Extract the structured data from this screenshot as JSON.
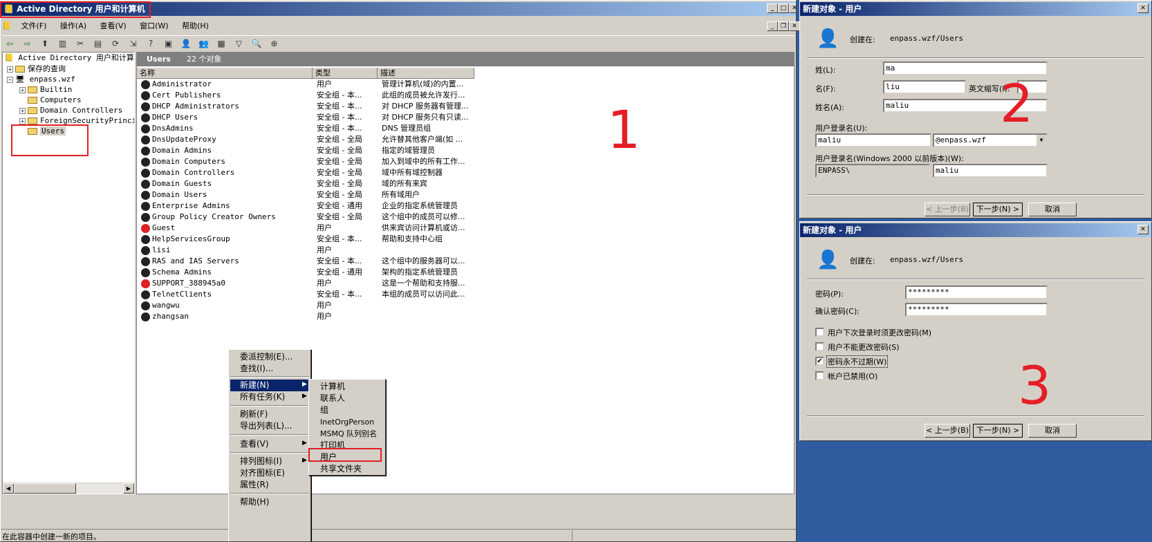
{
  "main_window": {
    "title": "Active Directory 用户和计算机",
    "menu": [
      "文件(F)",
      "操作(A)",
      "查看(V)",
      "窗口(W)",
      "帮助(H)"
    ],
    "tree_root": "Active Directory 用户和计算机",
    "tree": {
      "saved_queries": "保存的查询",
      "domain": "enpass.wzf",
      "children": [
        "Builtin",
        "Computers",
        "Domain Controllers",
        "ForeignSecurityPrincipals",
        "Users"
      ]
    },
    "panel_title": "Users",
    "object_count": "22 个对象",
    "columns": [
      "名称",
      "类型",
      "描述"
    ],
    "rows": [
      {
        "name": "Administrator",
        "type": "用户",
        "desc": "管理计算机(域)的内置...",
        "disabled": false
      },
      {
        "name": "Cert Publishers",
        "type": "安全组 - 本...",
        "desc": "此组的成员被允许发行...",
        "disabled": false
      },
      {
        "name": "DHCP Administrators",
        "type": "安全组 - 本...",
        "desc": "对 DHCP 服务器有管理...",
        "disabled": false
      },
      {
        "name": "DHCP Users",
        "type": "安全组 - 本...",
        "desc": "对 DHCP 服务只有只读...",
        "disabled": false
      },
      {
        "name": "DnsAdmins",
        "type": "安全组 - 本...",
        "desc": "DNS 管理员组",
        "disabled": false
      },
      {
        "name": "DnsUpdateProxy",
        "type": "安全组 - 全局",
        "desc": "允许替其他客户端(如 ...",
        "disabled": false
      },
      {
        "name": "Domain Admins",
        "type": "安全组 - 全局",
        "desc": "指定的域管理员",
        "disabled": false
      },
      {
        "name": "Domain Computers",
        "type": "安全组 - 全局",
        "desc": "加入到域中的所有工作...",
        "disabled": false
      },
      {
        "name": "Domain Controllers",
        "type": "安全组 - 全局",
        "desc": "域中所有域控制器",
        "disabled": false
      },
      {
        "name": "Domain Guests",
        "type": "安全组 - 全局",
        "desc": "域的所有来宾",
        "disabled": false
      },
      {
        "name": "Domain Users",
        "type": "安全组 - 全局",
        "desc": "所有域用户",
        "disabled": false
      },
      {
        "name": "Enterprise Admins",
        "type": "安全组 - 通用",
        "desc": "企业的指定系统管理员",
        "disabled": false
      },
      {
        "name": "Group Policy Creator Owners",
        "type": "安全组 - 全局",
        "desc": "这个组中的成员可以修...",
        "disabled": false
      },
      {
        "name": "Guest",
        "type": "用户",
        "desc": "供来宾访问计算机或访...",
        "disabled": true
      },
      {
        "name": "HelpServicesGroup",
        "type": "安全组 - 本...",
        "desc": "帮助和支持中心组",
        "disabled": false
      },
      {
        "name": "lisi",
        "type": "用户",
        "desc": "",
        "disabled": false
      },
      {
        "name": "RAS and IAS Servers",
        "type": "安全组 - 本...",
        "desc": "这个组中的服务器可以...",
        "disabled": false
      },
      {
        "name": "Schema Admins",
        "type": "安全组 - 通用",
        "desc": "架构的指定系统管理员",
        "disabled": false
      },
      {
        "name": "SUPPORT_388945a0",
        "type": "用户",
        "desc": "这是一个帮助和支持服...",
        "disabled": true
      },
      {
        "name": "TelnetClients",
        "type": "安全组 - 本...",
        "desc": "本组的成员可以访问此...",
        "disabled": false
      },
      {
        "name": "wangwu",
        "type": "用户",
        "desc": "",
        "disabled": false
      },
      {
        "name": "zhangsan",
        "type": "用户",
        "desc": "",
        "disabled": false
      }
    ],
    "status": "在此容器中创建一新的项目。"
  },
  "context_menu": {
    "items": [
      "委派控制(E)...",
      "查找(I)...",
      "新建(N)",
      "所有任务(K)",
      "刷新(F)",
      "导出列表(L)...",
      "查看(V)",
      "排列图标(I)",
      "对齐图标(E)",
      "属性(R)",
      "帮助(H)"
    ]
  },
  "submenu": {
    "items": [
      "计算机",
      "联系人",
      "组",
      "InetOrgPerson",
      "MSMQ 队列别名",
      "打印机",
      "用户",
      "共享文件夹"
    ]
  },
  "dialog1": {
    "title": "新建对象 - 用户",
    "created_in_label": "创建在:",
    "created_in": "enpass.wzf/Users",
    "last_name_label": "姓(L):",
    "last_name": "ma",
    "first_name_label": "名(F):",
    "first_name": "liu",
    "initials_label": "英文缩写(I):",
    "initials": "",
    "full_name_label": "姓名(A):",
    "full_name": "maliu",
    "logon_label": "用户登录名(U):",
    "logon": "maliu",
    "domain": "@enpass.wzf",
    "prewin_label": "用户登录名(Windows 2000 以前版本)(W):",
    "prewin_domain": "ENPASS\\",
    "prewin_name": "maliu",
    "back": "< 上一步(B)",
    "next": "下一步(N) >",
    "cancel": "取消"
  },
  "dialog2": {
    "title": "新建对象 - 用户",
    "created_in_label": "创建在:",
    "created_in": "enpass.wzf/Users",
    "password_label": "密码(P):",
    "password": "*********",
    "confirm_label": "确认密码(C):",
    "confirm": "*********",
    "options": [
      {
        "label": "用户下次登录时须更改密码(M)",
        "checked": false
      },
      {
        "label": "用户不能更改密码(S)",
        "checked": false
      },
      {
        "label": "密码永不过期(W)",
        "checked": true
      },
      {
        "label": "帐户已禁用(O)",
        "checked": false
      }
    ],
    "back": "< 上一步(B)",
    "next": "下一步(N) >",
    "cancel": "取消"
  },
  "annotations": [
    "1",
    "2",
    "3"
  ],
  "colors": {
    "annotation": "#e41e26",
    "title_start": "#0a246a",
    "desktop": "#2e5c9e",
    "chrome": "#d4d0c8"
  }
}
